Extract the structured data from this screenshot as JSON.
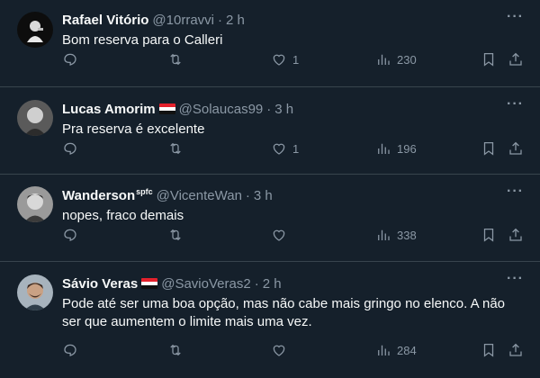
{
  "tweets": [
    {
      "name": "Rafael Vitório",
      "handle": "@10rravvi",
      "time": "2 h",
      "text": "Bom reserva para o Calleri",
      "likes": "1",
      "views": "230",
      "has_flag": false
    },
    {
      "name": "Lucas Amorim",
      "handle": "@Solaucas99",
      "time": "3 h",
      "text": "Pra reserva é excelente",
      "likes": "1",
      "views": "196",
      "has_flag": true
    },
    {
      "name": "Wanderson",
      "name_suffix": "spfc",
      "handle": "@VicenteWan",
      "time": "3 h",
      "text": "nopes, fraco demais",
      "likes": "",
      "views": "338",
      "has_flag": false
    },
    {
      "name": "Sávio Veras",
      "handle": "@SavioVeras2",
      "time": "2 h",
      "text": "Pode até ser uma boa opção, mas não cabe mais gringo no elenco. A não ser que aumentem o limite mais uma vez.",
      "likes": "",
      "views": "284",
      "has_flag": true
    }
  ],
  "separator": "·",
  "more_glyph": "···",
  "icons": {
    "reply": "reply-icon",
    "retweet": "retweet-icon",
    "like": "heart-icon",
    "views": "views-icon",
    "bookmark": "bookmark-icon",
    "share": "share-icon"
  },
  "colors": {
    "background": "#15202b",
    "text": "#f7f9f9",
    "muted": "#8b98a5",
    "border": "#38444d"
  }
}
